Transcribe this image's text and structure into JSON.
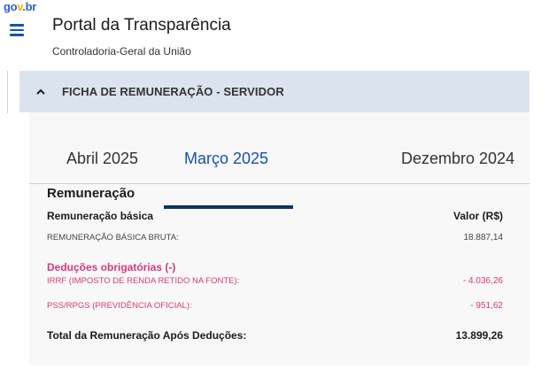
{
  "header": {
    "logo": {
      "part1": "go",
      "part2": "v",
      "part3": ".br"
    },
    "title": "Portal da Transparência",
    "subtitle": "Controladoria-Geral da União",
    "menu_icon": "hamburger-menu-icon"
  },
  "accordion": {
    "title": "FICHA DE REMUNERAÇÃO - SERVIDOR",
    "icon": "chevron-up-icon",
    "expanded": true
  },
  "tabs": [
    {
      "label": "Abril 2025",
      "active": false
    },
    {
      "label": "Março 2025",
      "active": true
    },
    {
      "label": "Dezembro 2024",
      "active": false
    }
  ],
  "remuneration": {
    "section_title": "Remuneração",
    "basic_heading": "Remuneração básica",
    "value_heading": "Valor (R$)",
    "gross_label": "REMUNERAÇÃO BÁSICA BRUTA:",
    "gross_value": "18.887,14",
    "deductions_title": "Deduções obrigatórias (-)",
    "deductions": [
      {
        "label": "IRRF (IMPOSTO DE RENDA RETIDO NA FONTE):",
        "value": "- 4.036,26"
      },
      {
        "label": "PSS/RPGS (PREVIDÊNCIA OFICIAL):",
        "value": "- 951,62"
      }
    ],
    "total_label": "Total da Remuneração Após Deduções:",
    "total_value": "13.899,26"
  },
  "colors": {
    "accordion_bg": "#dbe3ef",
    "active_tab": "#1351b4",
    "tab_underline": "#0c326f",
    "deduction": "#d63a7a"
  }
}
